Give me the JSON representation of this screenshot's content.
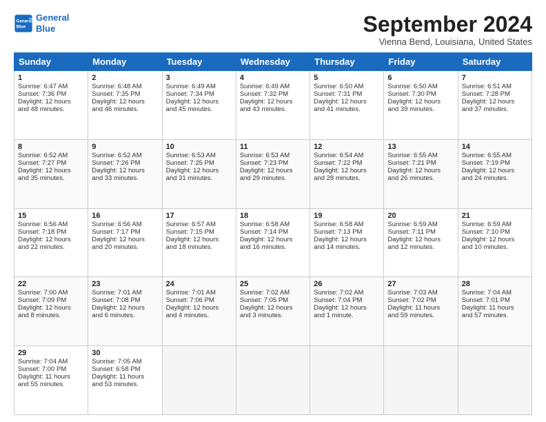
{
  "logo": {
    "line1": "General",
    "line2": "Blue"
  },
  "title": "September 2024",
  "location": "Vienna Bend, Louisiana, United States",
  "headers": [
    "Sunday",
    "Monday",
    "Tuesday",
    "Wednesday",
    "Thursday",
    "Friday",
    "Saturday"
  ],
  "weeks": [
    [
      {
        "day": "1",
        "info": "Sunrise: 6:47 AM\nSunset: 7:36 PM\nDaylight: 12 hours\nand 48 minutes."
      },
      {
        "day": "2",
        "info": "Sunrise: 6:48 AM\nSunset: 7:35 PM\nDaylight: 12 hours\nand 46 minutes."
      },
      {
        "day": "3",
        "info": "Sunrise: 6:49 AM\nSunset: 7:34 PM\nDaylight: 12 hours\nand 45 minutes."
      },
      {
        "day": "4",
        "info": "Sunrise: 6:49 AM\nSunset: 7:32 PM\nDaylight: 12 hours\nand 43 minutes."
      },
      {
        "day": "5",
        "info": "Sunrise: 6:50 AM\nSunset: 7:31 PM\nDaylight: 12 hours\nand 41 minutes."
      },
      {
        "day": "6",
        "info": "Sunrise: 6:50 AM\nSunset: 7:30 PM\nDaylight: 12 hours\nand 39 minutes."
      },
      {
        "day": "7",
        "info": "Sunrise: 6:51 AM\nSunset: 7:28 PM\nDaylight: 12 hours\nand 37 minutes."
      }
    ],
    [
      {
        "day": "8",
        "info": "Sunrise: 6:52 AM\nSunset: 7:27 PM\nDaylight: 12 hours\nand 35 minutes."
      },
      {
        "day": "9",
        "info": "Sunrise: 6:52 AM\nSunset: 7:26 PM\nDaylight: 12 hours\nand 33 minutes."
      },
      {
        "day": "10",
        "info": "Sunrise: 6:53 AM\nSunset: 7:25 PM\nDaylight: 12 hours\nand 31 minutes."
      },
      {
        "day": "11",
        "info": "Sunrise: 6:53 AM\nSunset: 7:23 PM\nDaylight: 12 hours\nand 29 minutes."
      },
      {
        "day": "12",
        "info": "Sunrise: 6:54 AM\nSunset: 7:22 PM\nDaylight: 12 hours\nand 28 minutes."
      },
      {
        "day": "13",
        "info": "Sunrise: 6:55 AM\nSunset: 7:21 PM\nDaylight: 12 hours\nand 26 minutes."
      },
      {
        "day": "14",
        "info": "Sunrise: 6:55 AM\nSunset: 7:19 PM\nDaylight: 12 hours\nand 24 minutes."
      }
    ],
    [
      {
        "day": "15",
        "info": "Sunrise: 6:56 AM\nSunset: 7:18 PM\nDaylight: 12 hours\nand 22 minutes."
      },
      {
        "day": "16",
        "info": "Sunrise: 6:56 AM\nSunset: 7:17 PM\nDaylight: 12 hours\nand 20 minutes."
      },
      {
        "day": "17",
        "info": "Sunrise: 6:57 AM\nSunset: 7:15 PM\nDaylight: 12 hours\nand 18 minutes."
      },
      {
        "day": "18",
        "info": "Sunrise: 6:58 AM\nSunset: 7:14 PM\nDaylight: 12 hours\nand 16 minutes."
      },
      {
        "day": "19",
        "info": "Sunrise: 6:58 AM\nSunset: 7:13 PM\nDaylight: 12 hours\nand 14 minutes."
      },
      {
        "day": "20",
        "info": "Sunrise: 6:59 AM\nSunset: 7:11 PM\nDaylight: 12 hours\nand 12 minutes."
      },
      {
        "day": "21",
        "info": "Sunrise: 6:59 AM\nSunset: 7:10 PM\nDaylight: 12 hours\nand 10 minutes."
      }
    ],
    [
      {
        "day": "22",
        "info": "Sunrise: 7:00 AM\nSunset: 7:09 PM\nDaylight: 12 hours\nand 8 minutes."
      },
      {
        "day": "23",
        "info": "Sunrise: 7:01 AM\nSunset: 7:08 PM\nDaylight: 12 hours\nand 6 minutes."
      },
      {
        "day": "24",
        "info": "Sunrise: 7:01 AM\nSunset: 7:06 PM\nDaylight: 12 hours\nand 4 minutes."
      },
      {
        "day": "25",
        "info": "Sunrise: 7:02 AM\nSunset: 7:05 PM\nDaylight: 12 hours\nand 3 minutes."
      },
      {
        "day": "26",
        "info": "Sunrise: 7:02 AM\nSunset: 7:04 PM\nDaylight: 12 hours\nand 1 minute."
      },
      {
        "day": "27",
        "info": "Sunrise: 7:03 AM\nSunset: 7:02 PM\nDaylight: 11 hours\nand 59 minutes."
      },
      {
        "day": "28",
        "info": "Sunrise: 7:04 AM\nSunset: 7:01 PM\nDaylight: 11 hours\nand 57 minutes."
      }
    ],
    [
      {
        "day": "29",
        "info": "Sunrise: 7:04 AM\nSunset: 7:00 PM\nDaylight: 11 hours\nand 55 minutes."
      },
      {
        "day": "30",
        "info": "Sunrise: 7:05 AM\nSunset: 6:58 PM\nDaylight: 11 hours\nand 53 minutes."
      },
      {
        "day": "",
        "info": "",
        "empty": true
      },
      {
        "day": "",
        "info": "",
        "empty": true
      },
      {
        "day": "",
        "info": "",
        "empty": true
      },
      {
        "day": "",
        "info": "",
        "empty": true
      },
      {
        "day": "",
        "info": "",
        "empty": true
      }
    ]
  ]
}
